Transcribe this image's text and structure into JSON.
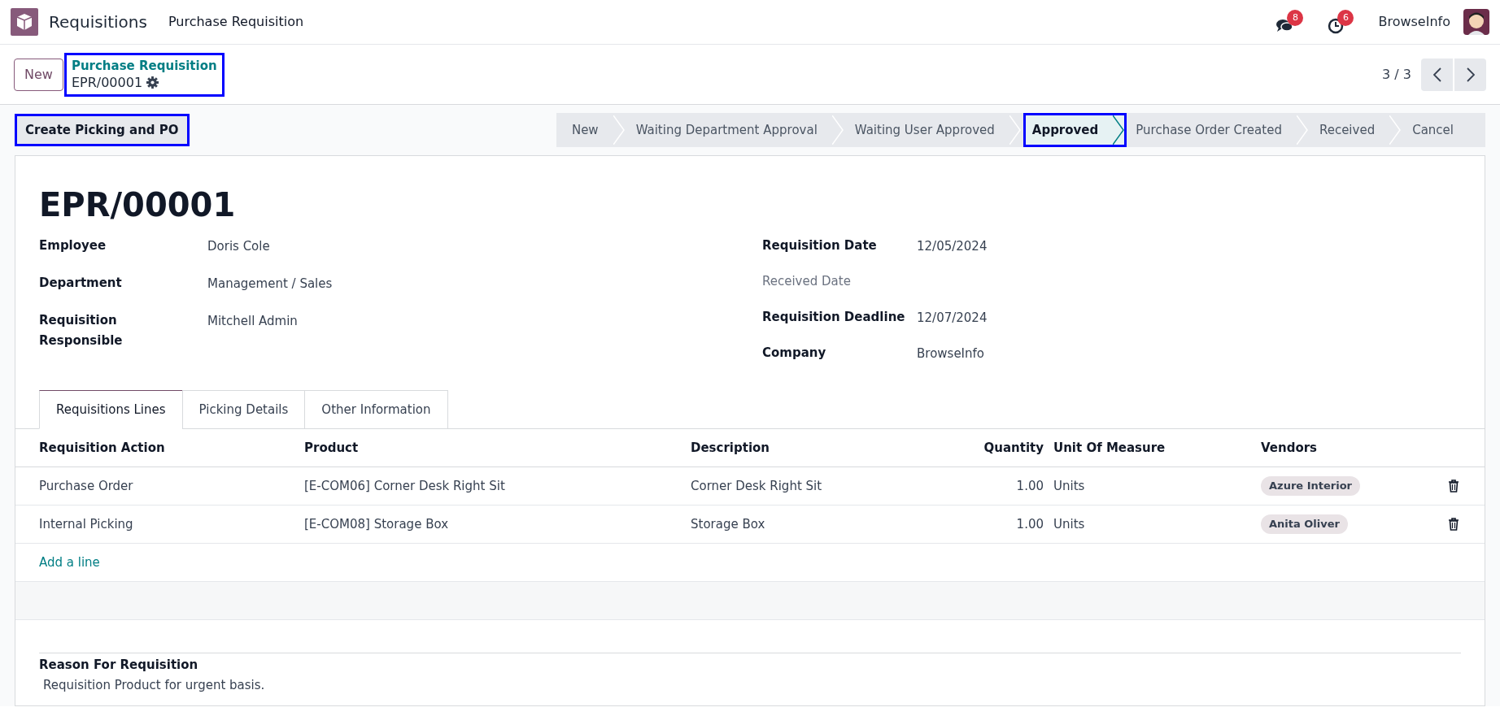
{
  "navbar": {
    "app_name": "Requisitions",
    "menu": [
      "Purchase Requisition"
    ],
    "messages_count": "8",
    "activities_count": "6",
    "company": "BrowseInfo"
  },
  "control_panel": {
    "new_button": "New",
    "breadcrumb": "Purchase Requisition",
    "record": "EPR/00001",
    "breadcrumb_highlighted": true,
    "pager": "3 / 3"
  },
  "action_button": {
    "label": "Create Picking and PO",
    "highlighted": true
  },
  "stages": [
    {
      "label": "New",
      "selected": false,
      "highlighted": false
    },
    {
      "label": "Waiting Department Approval",
      "selected": false,
      "highlighted": false
    },
    {
      "label": "Waiting User Approved",
      "selected": false,
      "highlighted": false
    },
    {
      "label": "Approved",
      "selected": true,
      "highlighted": true
    },
    {
      "label": "Purchase Order Created",
      "selected": false,
      "highlighted": false
    },
    {
      "label": "Received",
      "selected": false,
      "highlighted": false
    },
    {
      "label": "Cancel",
      "selected": false,
      "highlighted": false
    }
  ],
  "title": "EPR/00001",
  "left_fields": [
    {
      "label": "Employee",
      "value": "Doris Cole"
    },
    {
      "label": "Department",
      "value": "Management / Sales"
    },
    {
      "label": "Requisition Responsible",
      "value": "Mitchell Admin"
    }
  ],
  "right_fields": [
    {
      "label": "Requisition Date",
      "value": "12/05/2024",
      "muted": false
    },
    {
      "label": "Received Date",
      "muted": true
    },
    {
      "label": "Requisition Deadline",
      "value": "12/07/2024",
      "muted": false
    },
    {
      "label": "Company",
      "value": "BrowseInfo",
      "muted": false
    }
  ],
  "tabs": [
    {
      "label": "Requisitions Lines",
      "selected": true
    },
    {
      "label": "Picking Details",
      "selected": false
    },
    {
      "label": "Other Information",
      "selected": false
    }
  ],
  "table": {
    "columns": [
      "Requisition Action",
      "Product",
      "Description",
      "Quantity",
      "Unit Of Measure",
      "Vendors"
    ],
    "rows": [
      {
        "action": "Purchase Order",
        "product": "[E-COM06] Corner Desk Right Sit",
        "description": "Corner Desk Right Sit",
        "quantity": "1.00",
        "uom": "Units",
        "vendor": "Azure Interior"
      },
      {
        "action": "Internal Picking",
        "product": "[E-COM08] Storage Box",
        "description": "Storage Box",
        "quantity": "1.00",
        "uom": "Units",
        "vendor": "Anita Oliver"
      }
    ],
    "add_line": "Add a line"
  },
  "reason": {
    "label": "Reason For Requisition",
    "text": "Requisition Product for urgent basis."
  }
}
